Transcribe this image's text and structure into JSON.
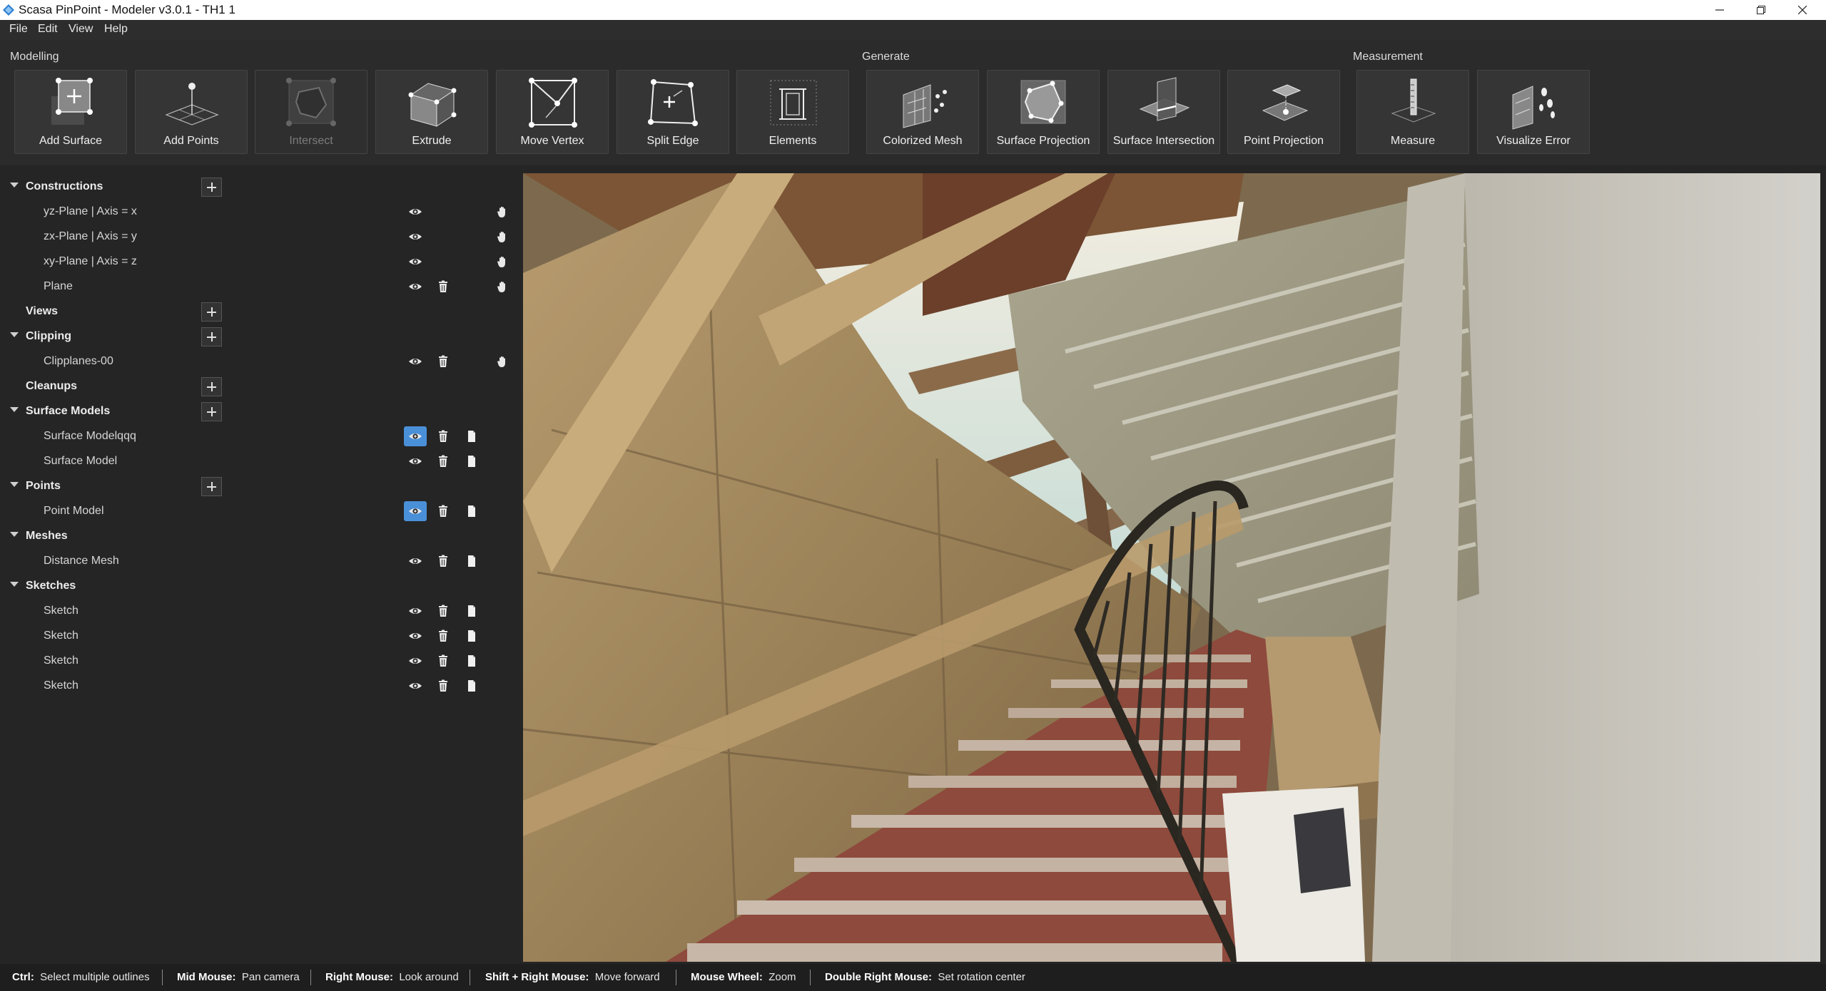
{
  "window": {
    "title": "Scasa PinPoint - Modeler v3.0.1 - TH1 1"
  },
  "menu": [
    "File",
    "Edit",
    "View",
    "Help"
  ],
  "ribbon": {
    "groups": [
      "Modelling",
      "Generate",
      "Measurement"
    ],
    "tools": [
      {
        "label": "Add Surface",
        "icon": "add-surface-icon",
        "enabled": true
      },
      {
        "label": "Add Points",
        "icon": "add-points-icon",
        "enabled": true
      },
      {
        "label": "Intersect",
        "icon": "intersect-icon",
        "enabled": false
      },
      {
        "label": "Extrude",
        "icon": "extrude-icon",
        "enabled": true
      },
      {
        "label": "Move Vertex",
        "icon": "move-vertex-icon",
        "enabled": true
      },
      {
        "label": "Split Edge",
        "icon": "split-edge-icon",
        "enabled": true
      },
      {
        "label": "Elements",
        "icon": "elements-icon",
        "enabled": true
      },
      {
        "label": "Colorized Mesh",
        "icon": "colorized-mesh-icon",
        "enabled": true
      },
      {
        "label": "Surface Projection",
        "icon": "surface-projection-icon",
        "enabled": true
      },
      {
        "label": "Surface Intersection",
        "icon": "surface-intersection-icon",
        "enabled": true
      },
      {
        "label": "Point Projection",
        "icon": "point-projection-icon",
        "enabled": true
      },
      {
        "label": "Measure",
        "icon": "measure-icon",
        "enabled": true
      },
      {
        "label": "Visualize Error",
        "icon": "visualize-error-icon",
        "enabled": true
      }
    ]
  },
  "tree": {
    "headers": {
      "constructions": "Constructions",
      "views": "Views",
      "clipping": "Clipping",
      "cleanups": "Cleanups",
      "surface_models": "Surface Models",
      "points": "Points",
      "meshes": "Meshes",
      "sketches": "Sketches"
    },
    "items": {
      "yz_plane": "yz-Plane | Axis = x",
      "zx_plane": "zx-Plane | Axis = y",
      "xy_plane": "xy-Plane | Axis = z",
      "plane": "Plane",
      "clipplanes": "Clipplanes-00",
      "surface_model_1": "Surface Modelqqq",
      "surface_model_2": "Surface Model",
      "point_model": "Point Model",
      "distance_mesh": "Distance Mesh",
      "sketch_1": "Sketch",
      "sketch_2": "Sketch",
      "sketch_3": "Sketch",
      "sketch_4": "Sketch"
    },
    "active_visibility": [
      "surface_model_1",
      "point_model"
    ]
  },
  "statusbar": {
    "hints": [
      {
        "key": "Ctrl:",
        "action": "Select multiple outlines"
      },
      {
        "key": "Mid Mouse:",
        "action": "Pan camera"
      },
      {
        "key": "Right Mouse:",
        "action": "Look around"
      },
      {
        "key": "Shift + Right Mouse:",
        "action": "Move forward"
      },
      {
        "key": "Mouse Wheel:",
        "action": "Zoom"
      },
      {
        "key": "Double Right Mouse:",
        "action": "Set rotation center"
      }
    ]
  },
  "colors": {
    "accent": "#4a90d9",
    "panel": "#252525",
    "ribbon": "#2b2b2b",
    "button": "#353535"
  }
}
